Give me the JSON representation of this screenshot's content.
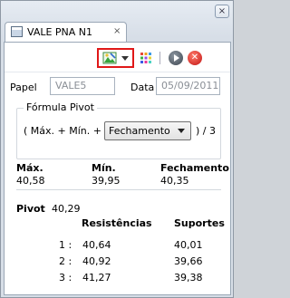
{
  "window": {
    "close_label": "×"
  },
  "tab": {
    "title": "VALE PNA N1",
    "close_label": "×"
  },
  "toolbar": {
    "picture_icon": "image-picture-icon",
    "grid_icon": "color-grid-icon",
    "play_icon": "play-icon",
    "stop_icon": "stop-icon",
    "stop_glyph": "✕",
    "menu_icon": "view-menu-icon"
  },
  "form": {
    "papel_label": "Papel",
    "papel_value": "VALE5",
    "data_label": "Data",
    "data_value": "05/09/2011"
  },
  "formula": {
    "title": "Fórmula Pivot",
    "prefix": "( Máx. + Mín. +",
    "select_value": "Fechamento",
    "suffix": ") / 3"
  },
  "stats": {
    "max_label": "Máx.",
    "max_value": "40,58",
    "min_label": "Mín.",
    "min_value": "39,95",
    "close_label": "Fechamento",
    "close_value": "40,35"
  },
  "pivot": {
    "label": "Pivot",
    "value": "40,29",
    "res_header": "Resistências",
    "sup_header": "Suportes",
    "rows": [
      {
        "n": "1 :",
        "res": "40,64",
        "sup": "40,01"
      },
      {
        "n": "2 :",
        "res": "40,92",
        "sup": "39,66"
      },
      {
        "n": "3 :",
        "res": "41,27",
        "sup": "39,38"
      }
    ]
  }
}
